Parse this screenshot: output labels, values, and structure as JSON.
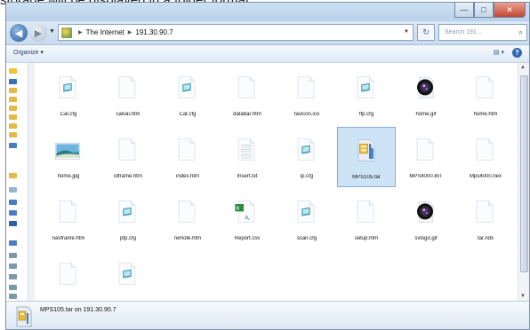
{
  "caption": "storage will be displayed in a folder format.",
  "window": {
    "buttons": {
      "minimize": "—",
      "maximize": "□",
      "close": "✕"
    }
  },
  "address": {
    "path": [
      "The Internet",
      "191.30.90.7"
    ],
    "search_placeholder": "Search 191..."
  },
  "toolbar": {
    "organize_label": "Organize ▾",
    "view_label": "▤ ▾",
    "help_label": "?"
  },
  "files": [
    {
      "name": "Cal.cfg",
      "icon": "cfg-document-icon"
    },
    {
      "name": "calval.htm",
      "icon": "blank-document-icon"
    },
    {
      "name": "Cat.cfg",
      "icon": "cfg-document-icon"
    },
    {
      "name": "databar.htm",
      "icon": "blank-document-icon"
    },
    {
      "name": "favicon.ico",
      "icon": "blank-document-icon"
    },
    {
      "name": "ftp.cfg",
      "icon": "cfg-document-icon"
    },
    {
      "name": "home.gif",
      "icon": "camera-lens-icon"
    },
    {
      "name": "home.htm",
      "icon": "blank-document-icon"
    },
    {
      "name": "home.jpg",
      "icon": "landscape-picture-icon"
    },
    {
      "name": "idframe.htm",
      "icon": "blank-document-icon"
    },
    {
      "name": "index.htm",
      "icon": "blank-document-icon"
    },
    {
      "name": "Insert.txt",
      "icon": "text-document-icon"
    },
    {
      "name": "ip.cfg",
      "icon": "cfg-document-icon"
    },
    {
      "name": "MPS105.tar",
      "icon": "archive-icon"
    },
    {
      "name": "MPS4000.BIT",
      "icon": "blank-document-icon"
    },
    {
      "name": "Mps4000.nex",
      "icon": "blank-document-icon"
    },
    {
      "name": "navframe.htm",
      "icon": "blank-document-icon"
    },
    {
      "name": "ptp.cfg",
      "icon": "cfg-document-icon"
    },
    {
      "name": "remote.htm",
      "icon": "blank-document-icon"
    },
    {
      "name": "Report.csv",
      "icon": "excel-csv-icon"
    },
    {
      "name": "scan.cfg",
      "icon": "cfg-document-icon"
    },
    {
      "name": "setup.htm",
      "icon": "blank-document-icon"
    },
    {
      "name": "svlogo.gif",
      "icon": "camera-lens-icon"
    },
    {
      "name": "tar.ndx",
      "icon": "blank-document-icon"
    },
    {
      "name": "",
      "icon": "blank-document-icon"
    },
    {
      "name": "",
      "icon": "cfg-document-icon"
    }
  ],
  "selected_file": "MPS105.tar",
  "status": {
    "text": "MPS105.tar on 191.30.90.7"
  }
}
